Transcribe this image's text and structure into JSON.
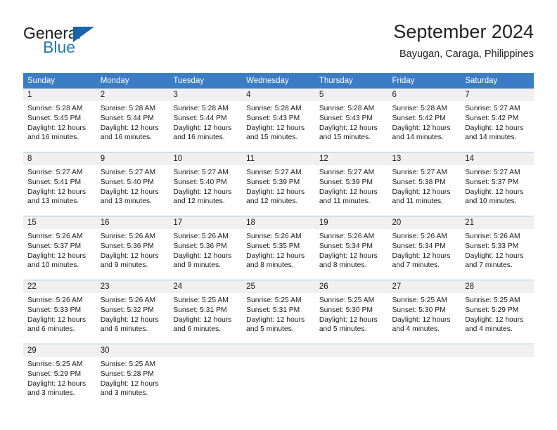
{
  "brand": {
    "line1": "General",
    "line2": "Blue",
    "accent_color": "#2478bf",
    "triangle_color": "#1565a8"
  },
  "header": {
    "title": "September 2024",
    "location": "Bayugan, Caraga, Philippines"
  },
  "theme": {
    "header_row_bg": "#3b7dc4",
    "daynum_band_bg": "#f0f0f0",
    "grid_line": "#a9c3dd"
  },
  "weekdays": [
    "Sunday",
    "Monday",
    "Tuesday",
    "Wednesday",
    "Thursday",
    "Friday",
    "Saturday"
  ],
  "labels": {
    "sunrise_prefix": "Sunrise:",
    "sunset_prefix": "Sunset:",
    "daylight_prefix": "Daylight:"
  },
  "weeks": [
    [
      {
        "day": "1",
        "sunrise": "Sunrise: 5:28 AM",
        "sunset": "Sunset: 5:45 PM",
        "daylight": "Daylight: 12 hours and 16 minutes."
      },
      {
        "day": "2",
        "sunrise": "Sunrise: 5:28 AM",
        "sunset": "Sunset: 5:44 PM",
        "daylight": "Daylight: 12 hours and 16 minutes."
      },
      {
        "day": "3",
        "sunrise": "Sunrise: 5:28 AM",
        "sunset": "Sunset: 5:44 PM",
        "daylight": "Daylight: 12 hours and 16 minutes."
      },
      {
        "day": "4",
        "sunrise": "Sunrise: 5:28 AM",
        "sunset": "Sunset: 5:43 PM",
        "daylight": "Daylight: 12 hours and 15 minutes."
      },
      {
        "day": "5",
        "sunrise": "Sunrise: 5:28 AM",
        "sunset": "Sunset: 5:43 PM",
        "daylight": "Daylight: 12 hours and 15 minutes."
      },
      {
        "day": "6",
        "sunrise": "Sunrise: 5:28 AM",
        "sunset": "Sunset: 5:42 PM",
        "daylight": "Daylight: 12 hours and 14 minutes."
      },
      {
        "day": "7",
        "sunrise": "Sunrise: 5:27 AM",
        "sunset": "Sunset: 5:42 PM",
        "daylight": "Daylight: 12 hours and 14 minutes."
      }
    ],
    [
      {
        "day": "8",
        "sunrise": "Sunrise: 5:27 AM",
        "sunset": "Sunset: 5:41 PM",
        "daylight": "Daylight: 12 hours and 13 minutes."
      },
      {
        "day": "9",
        "sunrise": "Sunrise: 5:27 AM",
        "sunset": "Sunset: 5:40 PM",
        "daylight": "Daylight: 12 hours and 13 minutes."
      },
      {
        "day": "10",
        "sunrise": "Sunrise: 5:27 AM",
        "sunset": "Sunset: 5:40 PM",
        "daylight": "Daylight: 12 hours and 12 minutes."
      },
      {
        "day": "11",
        "sunrise": "Sunrise: 5:27 AM",
        "sunset": "Sunset: 5:39 PM",
        "daylight": "Daylight: 12 hours and 12 minutes."
      },
      {
        "day": "12",
        "sunrise": "Sunrise: 5:27 AM",
        "sunset": "Sunset: 5:39 PM",
        "daylight": "Daylight: 12 hours and 11 minutes."
      },
      {
        "day": "13",
        "sunrise": "Sunrise: 5:27 AM",
        "sunset": "Sunset: 5:38 PM",
        "daylight": "Daylight: 12 hours and 11 minutes."
      },
      {
        "day": "14",
        "sunrise": "Sunrise: 5:27 AM",
        "sunset": "Sunset: 5:37 PM",
        "daylight": "Daylight: 12 hours and 10 minutes."
      }
    ],
    [
      {
        "day": "15",
        "sunrise": "Sunrise: 5:26 AM",
        "sunset": "Sunset: 5:37 PM",
        "daylight": "Daylight: 12 hours and 10 minutes."
      },
      {
        "day": "16",
        "sunrise": "Sunrise: 5:26 AM",
        "sunset": "Sunset: 5:36 PM",
        "daylight": "Daylight: 12 hours and 9 minutes."
      },
      {
        "day": "17",
        "sunrise": "Sunrise: 5:26 AM",
        "sunset": "Sunset: 5:36 PM",
        "daylight": "Daylight: 12 hours and 9 minutes."
      },
      {
        "day": "18",
        "sunrise": "Sunrise: 5:26 AM",
        "sunset": "Sunset: 5:35 PM",
        "daylight": "Daylight: 12 hours and 8 minutes."
      },
      {
        "day": "19",
        "sunrise": "Sunrise: 5:26 AM",
        "sunset": "Sunset: 5:34 PM",
        "daylight": "Daylight: 12 hours and 8 minutes."
      },
      {
        "day": "20",
        "sunrise": "Sunrise: 5:26 AM",
        "sunset": "Sunset: 5:34 PM",
        "daylight": "Daylight: 12 hours and 7 minutes."
      },
      {
        "day": "21",
        "sunrise": "Sunrise: 5:26 AM",
        "sunset": "Sunset: 5:33 PM",
        "daylight": "Daylight: 12 hours and 7 minutes."
      }
    ],
    [
      {
        "day": "22",
        "sunrise": "Sunrise: 5:26 AM",
        "sunset": "Sunset: 5:33 PM",
        "daylight": "Daylight: 12 hours and 6 minutes."
      },
      {
        "day": "23",
        "sunrise": "Sunrise: 5:26 AM",
        "sunset": "Sunset: 5:32 PM",
        "daylight": "Daylight: 12 hours and 6 minutes."
      },
      {
        "day": "24",
        "sunrise": "Sunrise: 5:25 AM",
        "sunset": "Sunset: 5:31 PM",
        "daylight": "Daylight: 12 hours and 6 minutes."
      },
      {
        "day": "25",
        "sunrise": "Sunrise: 5:25 AM",
        "sunset": "Sunset: 5:31 PM",
        "daylight": "Daylight: 12 hours and 5 minutes."
      },
      {
        "day": "26",
        "sunrise": "Sunrise: 5:25 AM",
        "sunset": "Sunset: 5:30 PM",
        "daylight": "Daylight: 12 hours and 5 minutes."
      },
      {
        "day": "27",
        "sunrise": "Sunrise: 5:25 AM",
        "sunset": "Sunset: 5:30 PM",
        "daylight": "Daylight: 12 hours and 4 minutes."
      },
      {
        "day": "28",
        "sunrise": "Sunrise: 5:25 AM",
        "sunset": "Sunset: 5:29 PM",
        "daylight": "Daylight: 12 hours and 4 minutes."
      }
    ],
    [
      {
        "day": "29",
        "sunrise": "Sunrise: 5:25 AM",
        "sunset": "Sunset: 5:29 PM",
        "daylight": "Daylight: 12 hours and 3 minutes."
      },
      {
        "day": "30",
        "sunrise": "Sunrise: 5:25 AM",
        "sunset": "Sunset: 5:28 PM",
        "daylight": "Daylight: 12 hours and 3 minutes."
      },
      {
        "day": "",
        "sunrise": "",
        "sunset": "",
        "daylight": "",
        "empty": true
      },
      {
        "day": "",
        "sunrise": "",
        "sunset": "",
        "daylight": "",
        "empty": true
      },
      {
        "day": "",
        "sunrise": "",
        "sunset": "",
        "daylight": "",
        "empty": true
      },
      {
        "day": "",
        "sunrise": "",
        "sunset": "",
        "daylight": "",
        "empty": true
      },
      {
        "day": "",
        "sunrise": "",
        "sunset": "",
        "daylight": "",
        "empty": true
      }
    ]
  ]
}
